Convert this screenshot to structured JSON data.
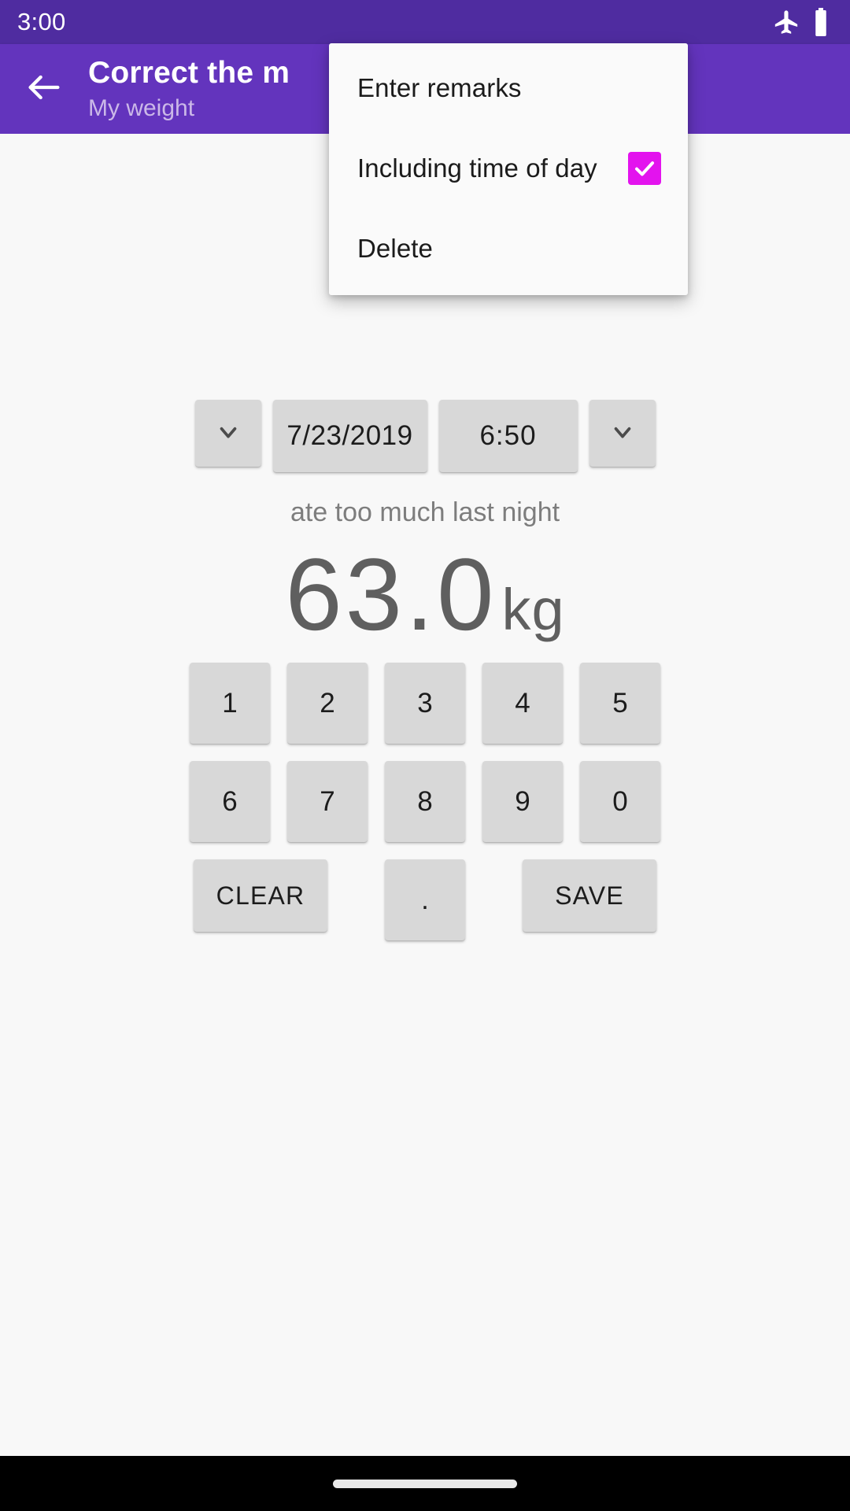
{
  "status_bar": {
    "clock": "3:00",
    "icons": [
      {
        "name": "airplane-mode-icon",
        "label": "Airplane mode"
      },
      {
        "name": "battery-icon",
        "label": "Battery full"
      }
    ]
  },
  "toolbar": {
    "back_icon": "back-arrow-icon",
    "title": "Correct the m",
    "subtitle": "My weight"
  },
  "popup_menu": {
    "items": [
      {
        "label": "Enter remarks",
        "has_checkbox": false,
        "checked": false
      },
      {
        "label": "Including time of day",
        "has_checkbox": true,
        "checked": true
      },
      {
        "label": "Delete",
        "has_checkbox": false,
        "checked": false
      }
    ],
    "checkbox_color": "#e313ee"
  },
  "entry": {
    "date_decrement_icon": "chevron-down-icon",
    "date_value": "7/23/2019",
    "time_value": "6:50",
    "time_decrement_icon": "chevron-down-icon",
    "remark": "ate too much last night",
    "weight_value": "63.0",
    "weight_unit": "kg"
  },
  "keypad": {
    "row1": [
      "1",
      "2",
      "3",
      "4",
      "5"
    ],
    "row2": [
      "6",
      "7",
      "8",
      "9",
      "0"
    ],
    "clear_label": "CLEAR",
    "dot_label": ".",
    "save_label": "SAVE"
  },
  "theme": {
    "status_bar_bg": "#4f2ca0",
    "toolbar_bg": "#6334bd",
    "page_bg": "#f8f8f8",
    "key_bg": "#d8d8d8",
    "accent": "#e313ee"
  }
}
